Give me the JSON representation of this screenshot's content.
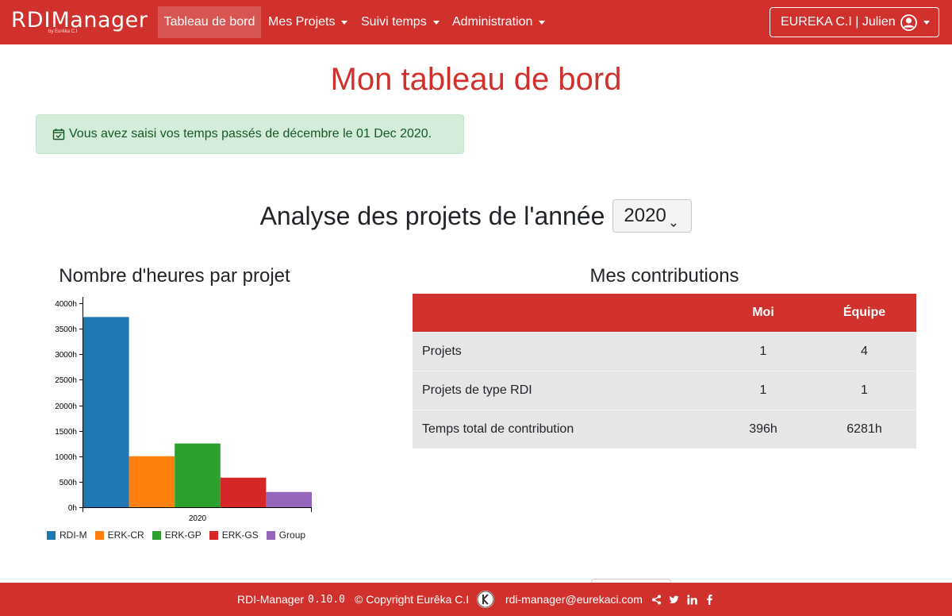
{
  "navbar": {
    "brand_main": "RDI",
    "brand_second": "Manager",
    "brand_sub": "by Eurêka C.I",
    "items": [
      {
        "label": "Tableau de bord",
        "active": true
      },
      {
        "label": "Mes Projets"
      },
      {
        "label": "Suivi temps"
      },
      {
        "label": "Administration"
      }
    ],
    "user": "EUREKA C.I | Julien",
    "user_icon": "user-circle-icon"
  },
  "page": {
    "title": "Mon tableau de bord",
    "alert": "Vous avez saisi vos temps passés de décembre le 01 Dec 2020.",
    "alert_icon": "calendar-check-icon"
  },
  "analysis": {
    "title": "Analyse des projets de l'année",
    "year": "2020"
  },
  "chart_data": {
    "type": "bar",
    "title": "Nombre d'heures par projet",
    "categories": [
      "2020"
    ],
    "series": [
      {
        "name": "RDI-M",
        "values": [
          3730
        ],
        "color": "#1f77b4"
      },
      {
        "name": "ERK-CR",
        "values": [
          1000
        ],
        "color": "#ff7f0e"
      },
      {
        "name": "ERK-GP",
        "values": [
          1250
        ],
        "color": "#2ca02c"
      },
      {
        "name": "ERK-GS",
        "values": [
          580
        ],
        "color": "#d62728"
      },
      {
        "name": "Group",
        "values": [
          300
        ],
        "color": "#9467bd"
      }
    ],
    "ylim": [
      0,
      4000
    ],
    "yticks": [
      0,
      500,
      1000,
      1500,
      2000,
      2500,
      3000,
      3500,
      4000
    ],
    "ytick_labels": [
      "0h",
      "500h",
      "1000h",
      "1500h",
      "2000h",
      "2500h",
      "3000h",
      "3500h",
      "4000h"
    ],
    "xlabel": "",
    "ylabel": "",
    "grid": false,
    "legend": "bottom"
  },
  "contributions": {
    "title": "Mes contributions",
    "headers": [
      "",
      "Moi",
      "Équipe"
    ],
    "rows": [
      {
        "label": "Projets",
        "me": "1",
        "team": "4"
      },
      {
        "label": "Projets de type RDI",
        "me": "1",
        "team": "1"
      },
      {
        "label": "Temps total de contribution",
        "me": "396h",
        "team": "6281h"
      }
    ]
  },
  "footer": {
    "app": "RDI-Manager",
    "version": "0.10.0",
    "copyright": "© Copyright Eurêka C.I",
    "email": "rdi-manager@eurekaci.com",
    "icons": [
      "share-icon",
      "twitter-icon",
      "linkedin-icon",
      "facebook-icon"
    ]
  },
  "colors": {
    "primary": "#d0312d",
    "alert_bg": "#d4edda",
    "alert_text": "#155724",
    "table_row": "#e6e6e6"
  }
}
